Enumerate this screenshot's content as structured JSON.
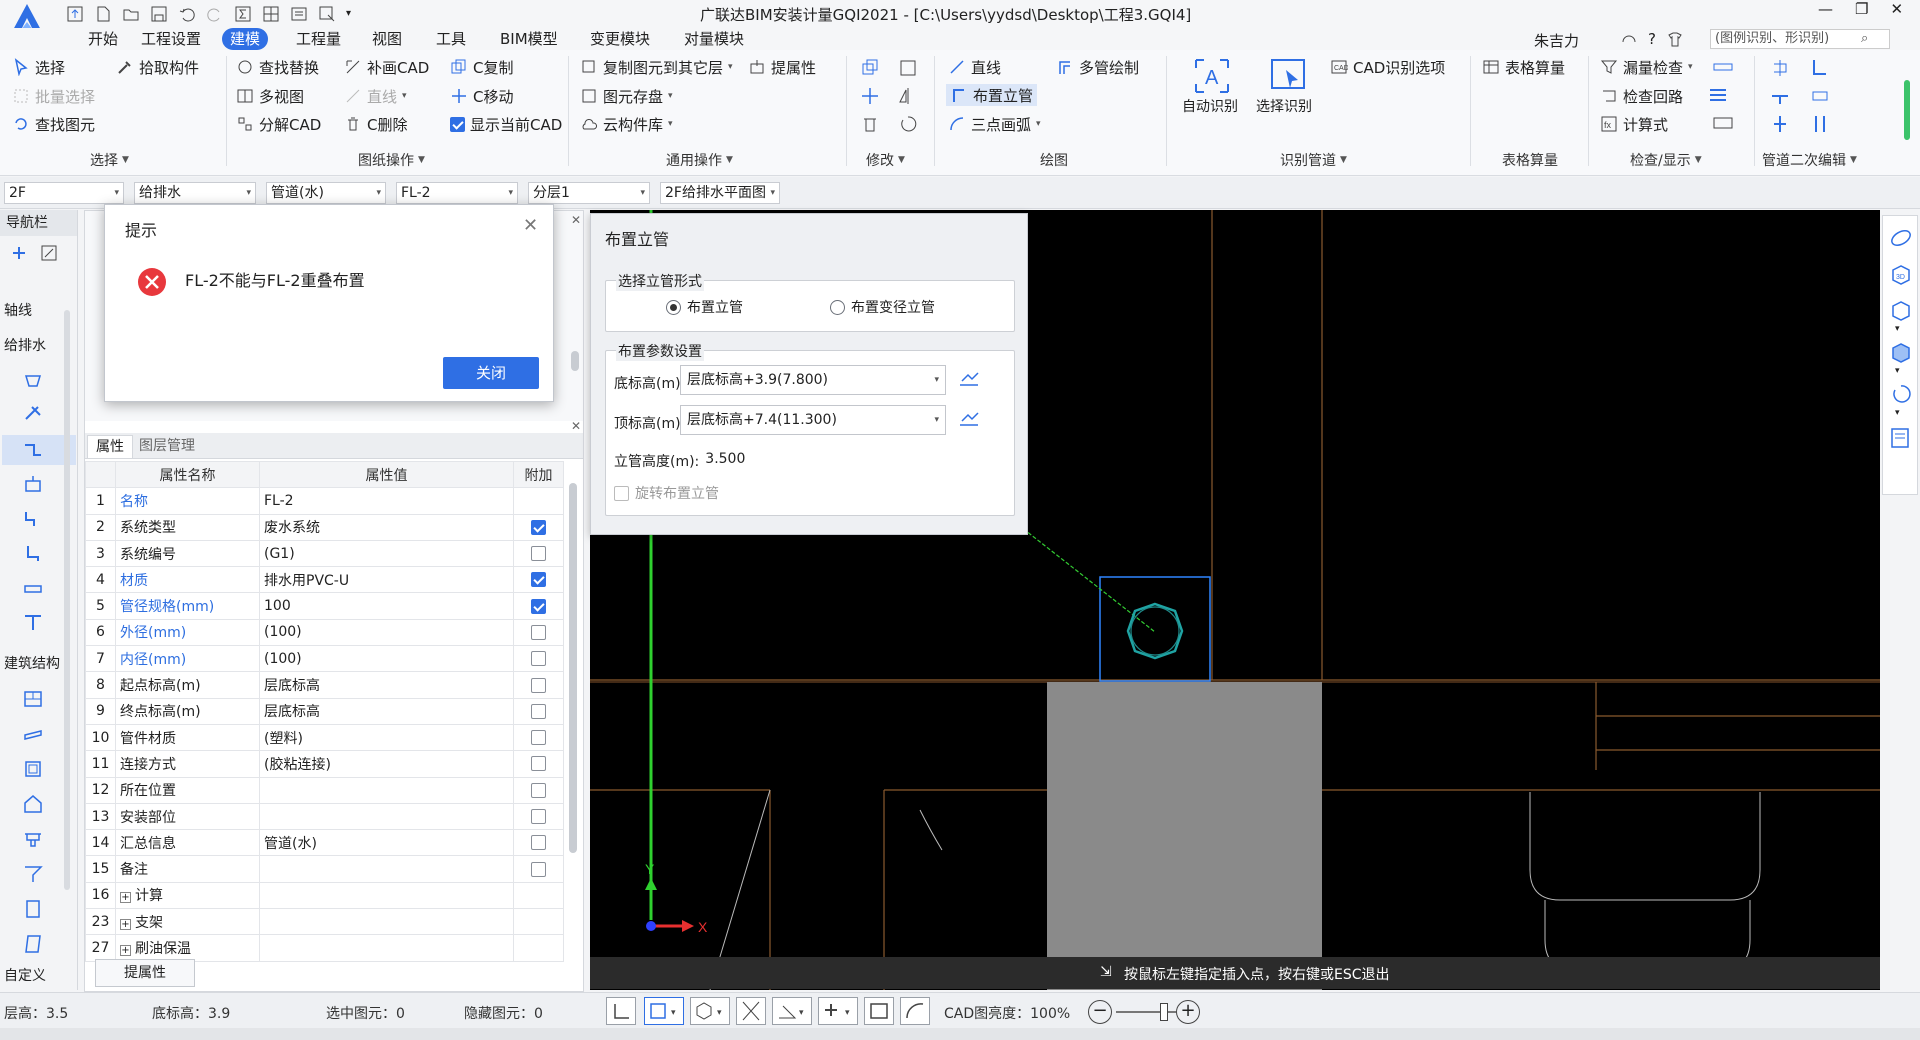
{
  "window": {
    "title": "广联达BIM安装计量GQI2021 - [C:\\Users\\yydsd\\Desktop\\工程3.GQI4]",
    "user": "朱吉力",
    "help": "?",
    "search_placeholder": "(图例识别、形识别)"
  },
  "tabs": [
    "开始",
    "工程设置",
    "建模",
    "工程量",
    "视图",
    "工具",
    "BIM模型",
    "变更模块",
    "对量模块"
  ],
  "ribbon": {
    "select": [
      "选择",
      "批量选择",
      "查找图元",
      "拾取构件"
    ],
    "drawing_ops": [
      "查找替换",
      "补画CAD",
      "C复制",
      "多视图",
      "直线",
      "C移动",
      "分解CAD",
      "C删除",
      "显示当前CAD"
    ],
    "common_ops": [
      "复制图元到其它层",
      "提属性",
      "图元存盘",
      "云构件库"
    ],
    "draw": [
      "直线",
      "多管绘制",
      "布置立管",
      "三点画弧"
    ],
    "recognize": [
      "自动识别",
      "选择识别",
      "CAD识别选项"
    ],
    "table": [
      "表格算量"
    ],
    "check": [
      "漏量检查",
      "检查回路",
      "计算式"
    ],
    "groups": {
      "select": "选择",
      "drawing_ops": "图纸操作",
      "common_ops": "通用操作",
      "modify": "修改",
      "draw": "绘图",
      "recognize": "识别管道",
      "table": "表格算量",
      "check": "检查/显示",
      "pipe_edit": "管道二次编辑"
    }
  },
  "selectors": [
    "2F",
    "给排水",
    "管道(水)",
    "FL-2",
    "分层1",
    "2F给排水平面图"
  ],
  "nav": {
    "title": "导航栏",
    "sections": [
      "轴线",
      "给排水",
      "建筑结构",
      "自定义"
    ]
  },
  "alert": {
    "title": "提示",
    "message": "FL-2不能与FL-2重叠布置",
    "button": "关闭"
  },
  "props": {
    "tabs": [
      "属性",
      "图层管理"
    ],
    "headers": [
      "属性名称",
      "属性值",
      "附加"
    ],
    "rows": [
      {
        "no": "1",
        "name": "名称",
        "value": "FL-2",
        "blue": true,
        "cb": null
      },
      {
        "no": "2",
        "name": "系统类型",
        "value": "废水系统",
        "blue": false,
        "cb": true
      },
      {
        "no": "3",
        "name": "系统编号",
        "value": "(G1)",
        "blue": false,
        "cb": false
      },
      {
        "no": "4",
        "name": "材质",
        "value": "排水用PVC-U",
        "blue": true,
        "cb": true
      },
      {
        "no": "5",
        "name": "管径规格(mm)",
        "value": "100",
        "blue": true,
        "cb": true
      },
      {
        "no": "6",
        "name": "外径(mm)",
        "value": "(100)",
        "blue": true,
        "cb": false
      },
      {
        "no": "7",
        "name": "内径(mm)",
        "value": "(100)",
        "blue": true,
        "cb": false
      },
      {
        "no": "8",
        "name": "起点标高(m)",
        "value": "层底标高",
        "blue": false,
        "cb": false
      },
      {
        "no": "9",
        "name": "终点标高(m)",
        "value": "层底标高",
        "blue": false,
        "cb": false
      },
      {
        "no": "10",
        "name": "管件材质",
        "value": "(塑料)",
        "blue": false,
        "cb": false
      },
      {
        "no": "11",
        "name": "连接方式",
        "value": "(胶粘连接)",
        "blue": false,
        "cb": false
      },
      {
        "no": "12",
        "name": "所在位置",
        "value": "",
        "blue": false,
        "cb": false
      },
      {
        "no": "13",
        "name": "安装部位",
        "value": "",
        "blue": false,
        "cb": false
      },
      {
        "no": "14",
        "name": "汇总信息",
        "value": "管道(水)",
        "blue": false,
        "cb": false
      },
      {
        "no": "15",
        "name": "备注",
        "value": "",
        "blue": false,
        "cb": false
      },
      {
        "no": "16",
        "name": "计算",
        "value": "",
        "blue": false,
        "cb": null,
        "plus": true
      },
      {
        "no": "23",
        "name": "支架",
        "value": "",
        "blue": false,
        "cb": null,
        "plus": true
      },
      {
        "no": "27",
        "name": "刷油保温",
        "value": "",
        "blue": false,
        "cb": null,
        "plus": true
      }
    ],
    "extract_button": "提属性"
  },
  "riser_dialog": {
    "title": "布置立管",
    "form_legend": "选择立管形式",
    "option1": "布置立管",
    "option2": "布置变径立管",
    "params_legend": "布置参数设置",
    "bottom_label": "底标高(m):",
    "bottom_value": "层底标高+3.9(7.800)",
    "top_label": "顶标高(m):",
    "top_value": "层底标高+7.4(11.300)",
    "height_label": "立管高度(m):",
    "height_value": "3.500",
    "rotate_label": "旋转布置立管"
  },
  "cad_hint": "按鼠标左键指定插入点，按右键或ESC退出",
  "status": {
    "floor_height": "层高：3.5",
    "bottom_elev": "底标高：3.9",
    "selected": "选中图元：0",
    "hidden": "隐藏图元：0",
    "cad_brightness": "CAD图亮度：100%"
  },
  "colors": {
    "accent": "#2f6fe4",
    "error": "#e8383d",
    "cad_bg": "#000000",
    "cad_line": "#8a5a2e",
    "pipe": "#1fa3a3"
  }
}
